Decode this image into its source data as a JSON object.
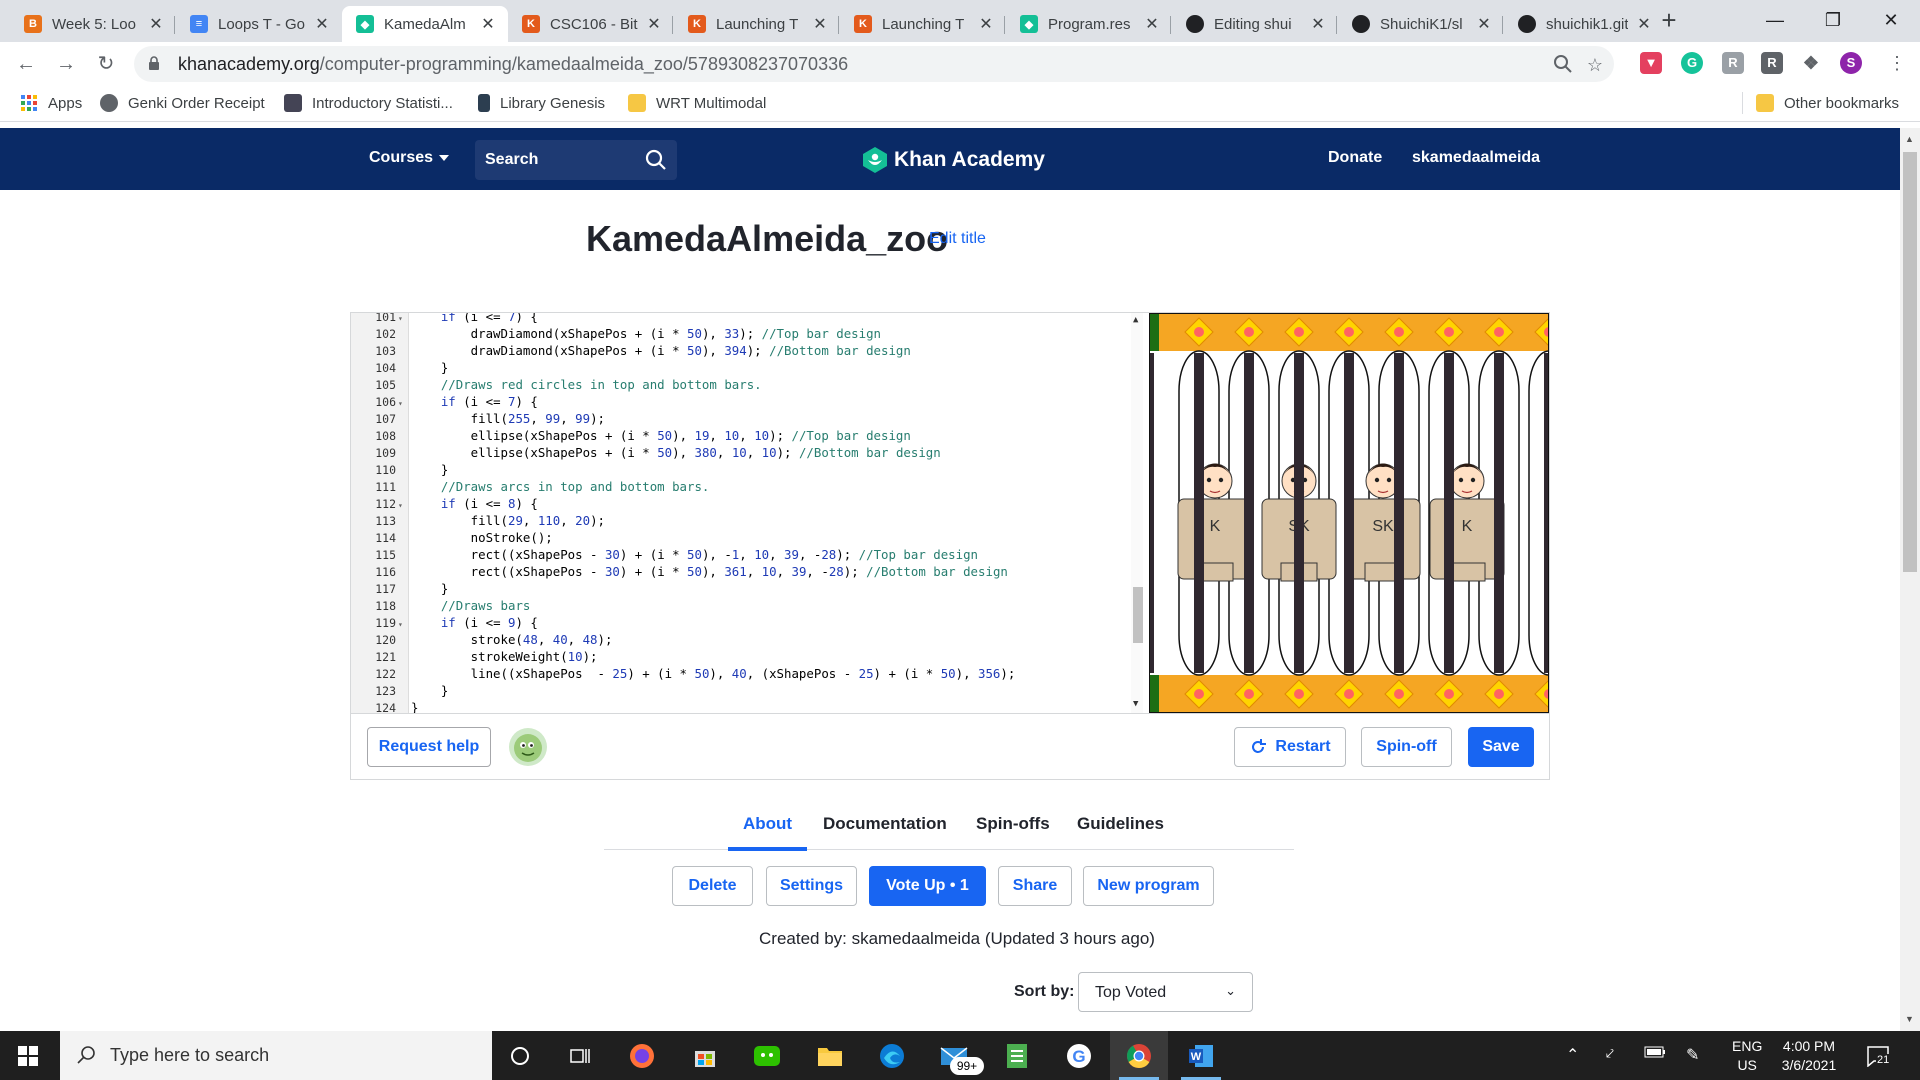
{
  "browser": {
    "tabs": [
      {
        "title": "Week 5: Loo",
        "color": "#e8711a",
        "glyph": "B"
      },
      {
        "title": "Loops T - Go",
        "color": "#4285f4",
        "glyph": "≡"
      },
      {
        "title": "KamedaAlm",
        "color": "#14bf96",
        "glyph": "◆",
        "active": true
      },
      {
        "title": "CSC106 - Bit",
        "color": "#e35a1c",
        "glyph": "K"
      },
      {
        "title": "Launching T",
        "color": "#e35a1c",
        "glyph": "K"
      },
      {
        "title": "Launching T",
        "color": "#e35a1c",
        "glyph": "K"
      },
      {
        "title": "Program.res",
        "color": "#14bf96",
        "glyph": "◆"
      },
      {
        "title": "Editing shui",
        "color": "#202124",
        "glyph": "●"
      },
      {
        "title": "ShuichiK1/sl",
        "color": "#202124",
        "glyph": "●"
      },
      {
        "title": "shuichik1.git",
        "color": "#202124",
        "glyph": "●"
      }
    ],
    "url_host": "khanacademy.org",
    "url_path": "/computer-programming/kamedaalmeida_zoo/5789308237070336",
    "bookmarks": [
      "Apps",
      "Genki Order Receipt",
      "Introductory Statisti...",
      "Library Genesis",
      "WRT Multimodal"
    ],
    "other_bookmarks": "Other bookmarks",
    "profile_initial": "S"
  },
  "header": {
    "courses": "Courses",
    "search": "Search",
    "logo": "Khan Academy",
    "donate": "Donate",
    "username": "skamedaalmeida"
  },
  "program": {
    "title": "KamedaAlmeida_zoo",
    "edit_title": "Edit title"
  },
  "code_lines": [
    {
      "n": "101",
      "fold": true,
      "html": "    <span class='kw'>if</span> (i &lt;= <span class='num'>7</span>) {"
    },
    {
      "n": "102",
      "fold": false,
      "html": "        drawDiamond(xShapePos + (i * <span class='num'>50</span>), <span class='num'>33</span>); <span class='cm'>//Top bar design</span>"
    },
    {
      "n": "103",
      "fold": false,
      "html": "        drawDiamond(xShapePos + (i * <span class='num'>50</span>), <span class='num'>394</span>); <span class='cm'>//Bottom bar design</span>"
    },
    {
      "n": "104",
      "fold": false,
      "html": "    }"
    },
    {
      "n": "105",
      "fold": false,
      "html": "    <span class='cm'>//Draws red circles in top and bottom bars.</span>"
    },
    {
      "n": "106",
      "fold": true,
      "html": "    <span class='kw'>if</span> (i &lt;= <span class='num'>7</span>) {"
    },
    {
      "n": "107",
      "fold": false,
      "html": "        fill(<span class='num'>255</span>, <span class='num'>99</span>, <span class='num'>99</span>);"
    },
    {
      "n": "108",
      "fold": false,
      "html": "        ellipse(xShapePos + (i * <span class='num'>50</span>), <span class='num'>19</span>, <span class='num'>10</span>, <span class='num'>10</span>); <span class='cm'>//Top bar design</span>"
    },
    {
      "n": "109",
      "fold": false,
      "html": "        ellipse(xShapePos + (i * <span class='num'>50</span>), <span class='num'>380</span>, <span class='num'>10</span>, <span class='num'>10</span>); <span class='cm'>//Bottom bar design</span>"
    },
    {
      "n": "110",
      "fold": false,
      "html": "    }"
    },
    {
      "n": "111",
      "fold": false,
      "html": "    <span class='cm'>//Draws arcs in top and bottom bars.</span>"
    },
    {
      "n": "112",
      "fold": true,
      "html": "    <span class='kw'>if</span> (i &lt;= <span class='num'>8</span>) {"
    },
    {
      "n": "113",
      "fold": false,
      "html": "        fill(<span class='num'>29</span>, <span class='num'>110</span>, <span class='num'>20</span>);"
    },
    {
      "n": "114",
      "fold": false,
      "html": "        noStroke();"
    },
    {
      "n": "115",
      "fold": false,
      "html": "        rect((xShapePos - <span class='num'>30</span>) + (i * <span class='num'>50</span>), -<span class='num'>1</span>, <span class='num'>10</span>, <span class='num'>39</span>, -<span class='num'>28</span>); <span class='cm'>//Top bar design</span>"
    },
    {
      "n": "116",
      "fold": false,
      "html": "        rect((xShapePos - <span class='num'>30</span>) + (i * <span class='num'>50</span>), <span class='num'>361</span>, <span class='num'>10</span>, <span class='num'>39</span>, -<span class='num'>28</span>); <span class='cm'>//Bottom bar design</span>"
    },
    {
      "n": "117",
      "fold": false,
      "html": "    }"
    },
    {
      "n": "118",
      "fold": false,
      "html": "    <span class='cm'>//Draws bars</span>"
    },
    {
      "n": "119",
      "fold": true,
      "html": "    <span class='kw'>if</span> (i &lt;= <span class='num'>9</span>) {"
    },
    {
      "n": "120",
      "fold": false,
      "html": "        stroke(<span class='num'>48</span>, <span class='num'>40</span>, <span class='num'>48</span>);"
    },
    {
      "n": "121",
      "fold": false,
      "html": "        strokeWeight(<span class='num'>10</span>);"
    },
    {
      "n": "122",
      "fold": false,
      "html": "        line((xShapePos  - <span class='num'>25</span>) + (i * <span class='num'>50</span>), <span class='num'>40</span>, (xShapePos - <span class='num'>25</span>) + (i * <span class='num'>50</span>), <span class='num'>356</span>);"
    },
    {
      "n": "123",
      "fold": false,
      "html": "    }"
    },
    {
      "n": "124",
      "fold": false,
      "html": "}"
    }
  ],
  "canvas": {
    "shirt_label": "SK",
    "shirt_labels_visible": [
      "K",
      "SK",
      "SK",
      "K"
    ]
  },
  "editor_footer": {
    "request_help": "Request help",
    "restart": "Restart",
    "spinoff": "Spin-off",
    "save": "Save"
  },
  "subtabs": [
    "About",
    "Documentation",
    "Spin-offs",
    "Guidelines"
  ],
  "actions": {
    "delete": "Delete",
    "settings": "Settings",
    "vote_up": "Vote Up • 1",
    "share": "Share",
    "new_program": "New program"
  },
  "created_by": "Created by: skamedaalmeida (Updated 3 hours ago)",
  "sort": {
    "label": "Sort by:",
    "value": "Top Voted"
  },
  "taskbar": {
    "search_placeholder": "Type here to search",
    "mail_badge": "99+",
    "lang_top": "ENG",
    "lang_bottom": "US",
    "time": "4:00 PM",
    "date": "3/6/2021",
    "notif_count": "21"
  },
  "colors": {
    "ka_navy": "#0a2a66",
    "ka_blue": "#1865f2",
    "bar_green": "#1d6e14",
    "diamond_orange": "#f5a623",
    "circle_red": "#ff6363",
    "cage_bar": "#302830"
  }
}
